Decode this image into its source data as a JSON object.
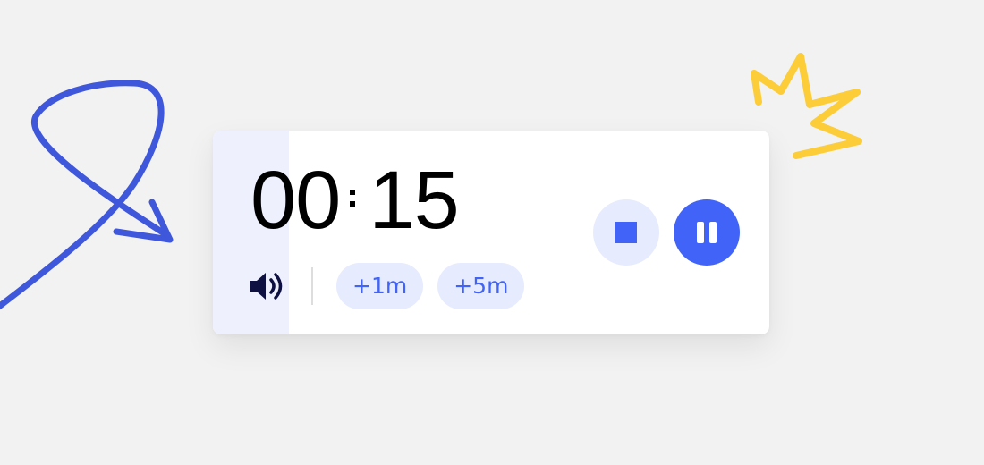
{
  "timer": {
    "minutes": "00",
    "seconds": "15",
    "progress_fraction": 0.137
  },
  "quick_add": [
    {
      "label": "+1m"
    },
    {
      "label": "+5m"
    }
  ],
  "icons": {
    "sound": "speaker-volume-icon",
    "stop": "stop-icon",
    "pause": "pause-icon"
  },
  "colors": {
    "background": "#f2f2f2",
    "card": "#ffffff",
    "progress": "#eef1fd",
    "accent": "#4163f7",
    "accent_light": "#e6ebfd",
    "speaker": "#0d1040",
    "doodle_blue": "#3f57db",
    "doodle_yellow": "#fccd38"
  }
}
